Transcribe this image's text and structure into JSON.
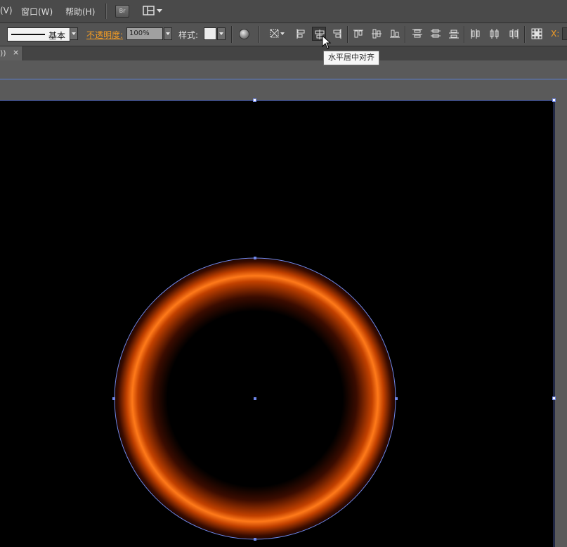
{
  "menubar": {
    "items": [
      {
        "label": "(V)"
      },
      {
        "label": "窗口(W)"
      },
      {
        "label": "帮助(H)"
      }
    ],
    "bridge_label": "Br",
    "workspace_icon": "layout-grid-icon"
  },
  "controlbar": {
    "stroke_style": "基本",
    "opacity_label": "不透明度:",
    "opacity_value": "100%",
    "style_label": "样式:",
    "x_label": "X:",
    "accent_color": "#f39c24",
    "align_buttons": [
      {
        "name": "align-left-icon"
      },
      {
        "name": "align-horizontal-center-icon",
        "active": true
      },
      {
        "name": "align-right-icon"
      },
      {
        "name": "align-top-icon"
      },
      {
        "name": "align-vertical-center-icon"
      },
      {
        "name": "align-bottom-icon"
      },
      {
        "name": "distribute-top-icon"
      },
      {
        "name": "distribute-vertical-center-icon"
      },
      {
        "name": "distribute-bottom-icon"
      },
      {
        "name": "distribute-left-icon"
      },
      {
        "name": "distribute-horizontal-center-icon"
      },
      {
        "name": "distribute-right-icon"
      }
    ]
  },
  "tabbar": {
    "tab_label": "))",
    "close_glyph": "×"
  },
  "tooltip": {
    "text": "水平居中对齐"
  },
  "canvas": {
    "artboard_color": "#000000",
    "selection_color": "#6e86e8",
    "ring_colors": [
      "#000000",
      "#3b0c00",
      "#c24100",
      "#ff7a1a",
      "#c24100",
      "#3b0c00"
    ]
  }
}
